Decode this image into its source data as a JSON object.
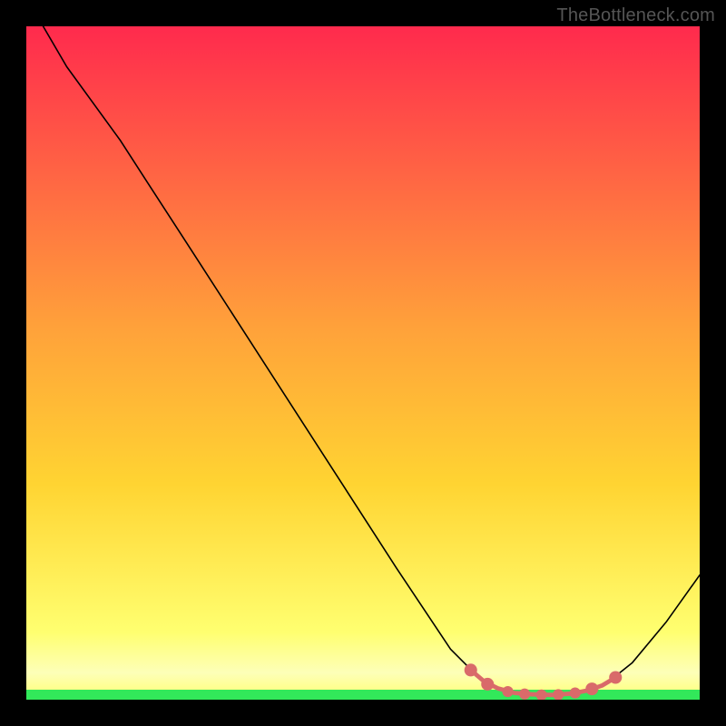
{
  "watermark": "TheBottleneck.com",
  "chart_data": {
    "type": "line",
    "title": "",
    "xlabel": "",
    "ylabel": "",
    "xlim": [
      0,
      100
    ],
    "ylim": [
      0,
      100
    ],
    "background_gradient": {
      "top_color": "#ff2a4d",
      "mid_color": "#ffd432",
      "lower_color": "#ffff70",
      "bottom_band_color": "#32e85a"
    },
    "series": [
      {
        "name": "bottleneck-curve",
        "stroke": "#000000",
        "points": [
          {
            "x": 2.5,
            "y": 100.0
          },
          {
            "x": 6.0,
            "y": 94.0
          },
          {
            "x": 10.0,
            "y": 88.5
          },
          {
            "x": 14.0,
            "y": 83.0
          },
          {
            "x": 18.0,
            "y": 76.8
          },
          {
            "x": 25.0,
            "y": 66.0
          },
          {
            "x": 35.0,
            "y": 50.5
          },
          {
            "x": 45.0,
            "y": 35.0
          },
          {
            "x": 55.0,
            "y": 19.5
          },
          {
            "x": 63.0,
            "y": 7.5
          },
          {
            "x": 67.0,
            "y": 3.5
          },
          {
            "x": 70.0,
            "y": 1.6
          },
          {
            "x": 73.0,
            "y": 0.9
          },
          {
            "x": 77.0,
            "y": 0.7
          },
          {
            "x": 81.0,
            "y": 0.9
          },
          {
            "x": 84.0,
            "y": 1.6
          },
          {
            "x": 86.5,
            "y": 2.7
          },
          {
            "x": 90.0,
            "y": 5.5
          },
          {
            "x": 95.0,
            "y": 11.5
          },
          {
            "x": 100.0,
            "y": 18.5
          }
        ]
      },
      {
        "name": "optimal-range-highlight",
        "stroke": "#d96a6a",
        "stroke_width": 4.8,
        "points": [
          {
            "x": 66.0,
            "y": 4.4
          },
          {
            "x": 68.0,
            "y": 2.7
          },
          {
            "x": 70.0,
            "y": 1.7
          },
          {
            "x": 72.5,
            "y": 1.0
          },
          {
            "x": 75.0,
            "y": 0.8
          },
          {
            "x": 78.0,
            "y": 0.7
          },
          {
            "x": 81.0,
            "y": 0.9
          },
          {
            "x": 83.5,
            "y": 1.4
          },
          {
            "x": 85.5,
            "y": 2.1
          },
          {
            "x": 87.5,
            "y": 3.3
          }
        ]
      }
    ],
    "markers": [
      {
        "x": 66.0,
        "y": 4.4,
        "r": 2.2,
        "fill": "#d96a6a"
      },
      {
        "x": 68.5,
        "y": 2.3,
        "r": 2.2,
        "fill": "#d96a6a"
      },
      {
        "x": 71.5,
        "y": 1.2,
        "r": 1.9,
        "fill": "#d96a6a"
      },
      {
        "x": 74.0,
        "y": 0.85,
        "r": 1.9,
        "fill": "#d96a6a"
      },
      {
        "x": 76.5,
        "y": 0.7,
        "r": 1.9,
        "fill": "#d96a6a"
      },
      {
        "x": 79.0,
        "y": 0.75,
        "r": 1.9,
        "fill": "#d96a6a"
      },
      {
        "x": 81.5,
        "y": 1.0,
        "r": 1.9,
        "fill": "#d96a6a"
      },
      {
        "x": 84.0,
        "y": 1.6,
        "r": 2.2,
        "fill": "#d96a6a"
      },
      {
        "x": 87.5,
        "y": 3.3,
        "r": 2.2,
        "fill": "#d96a6a"
      }
    ]
  }
}
